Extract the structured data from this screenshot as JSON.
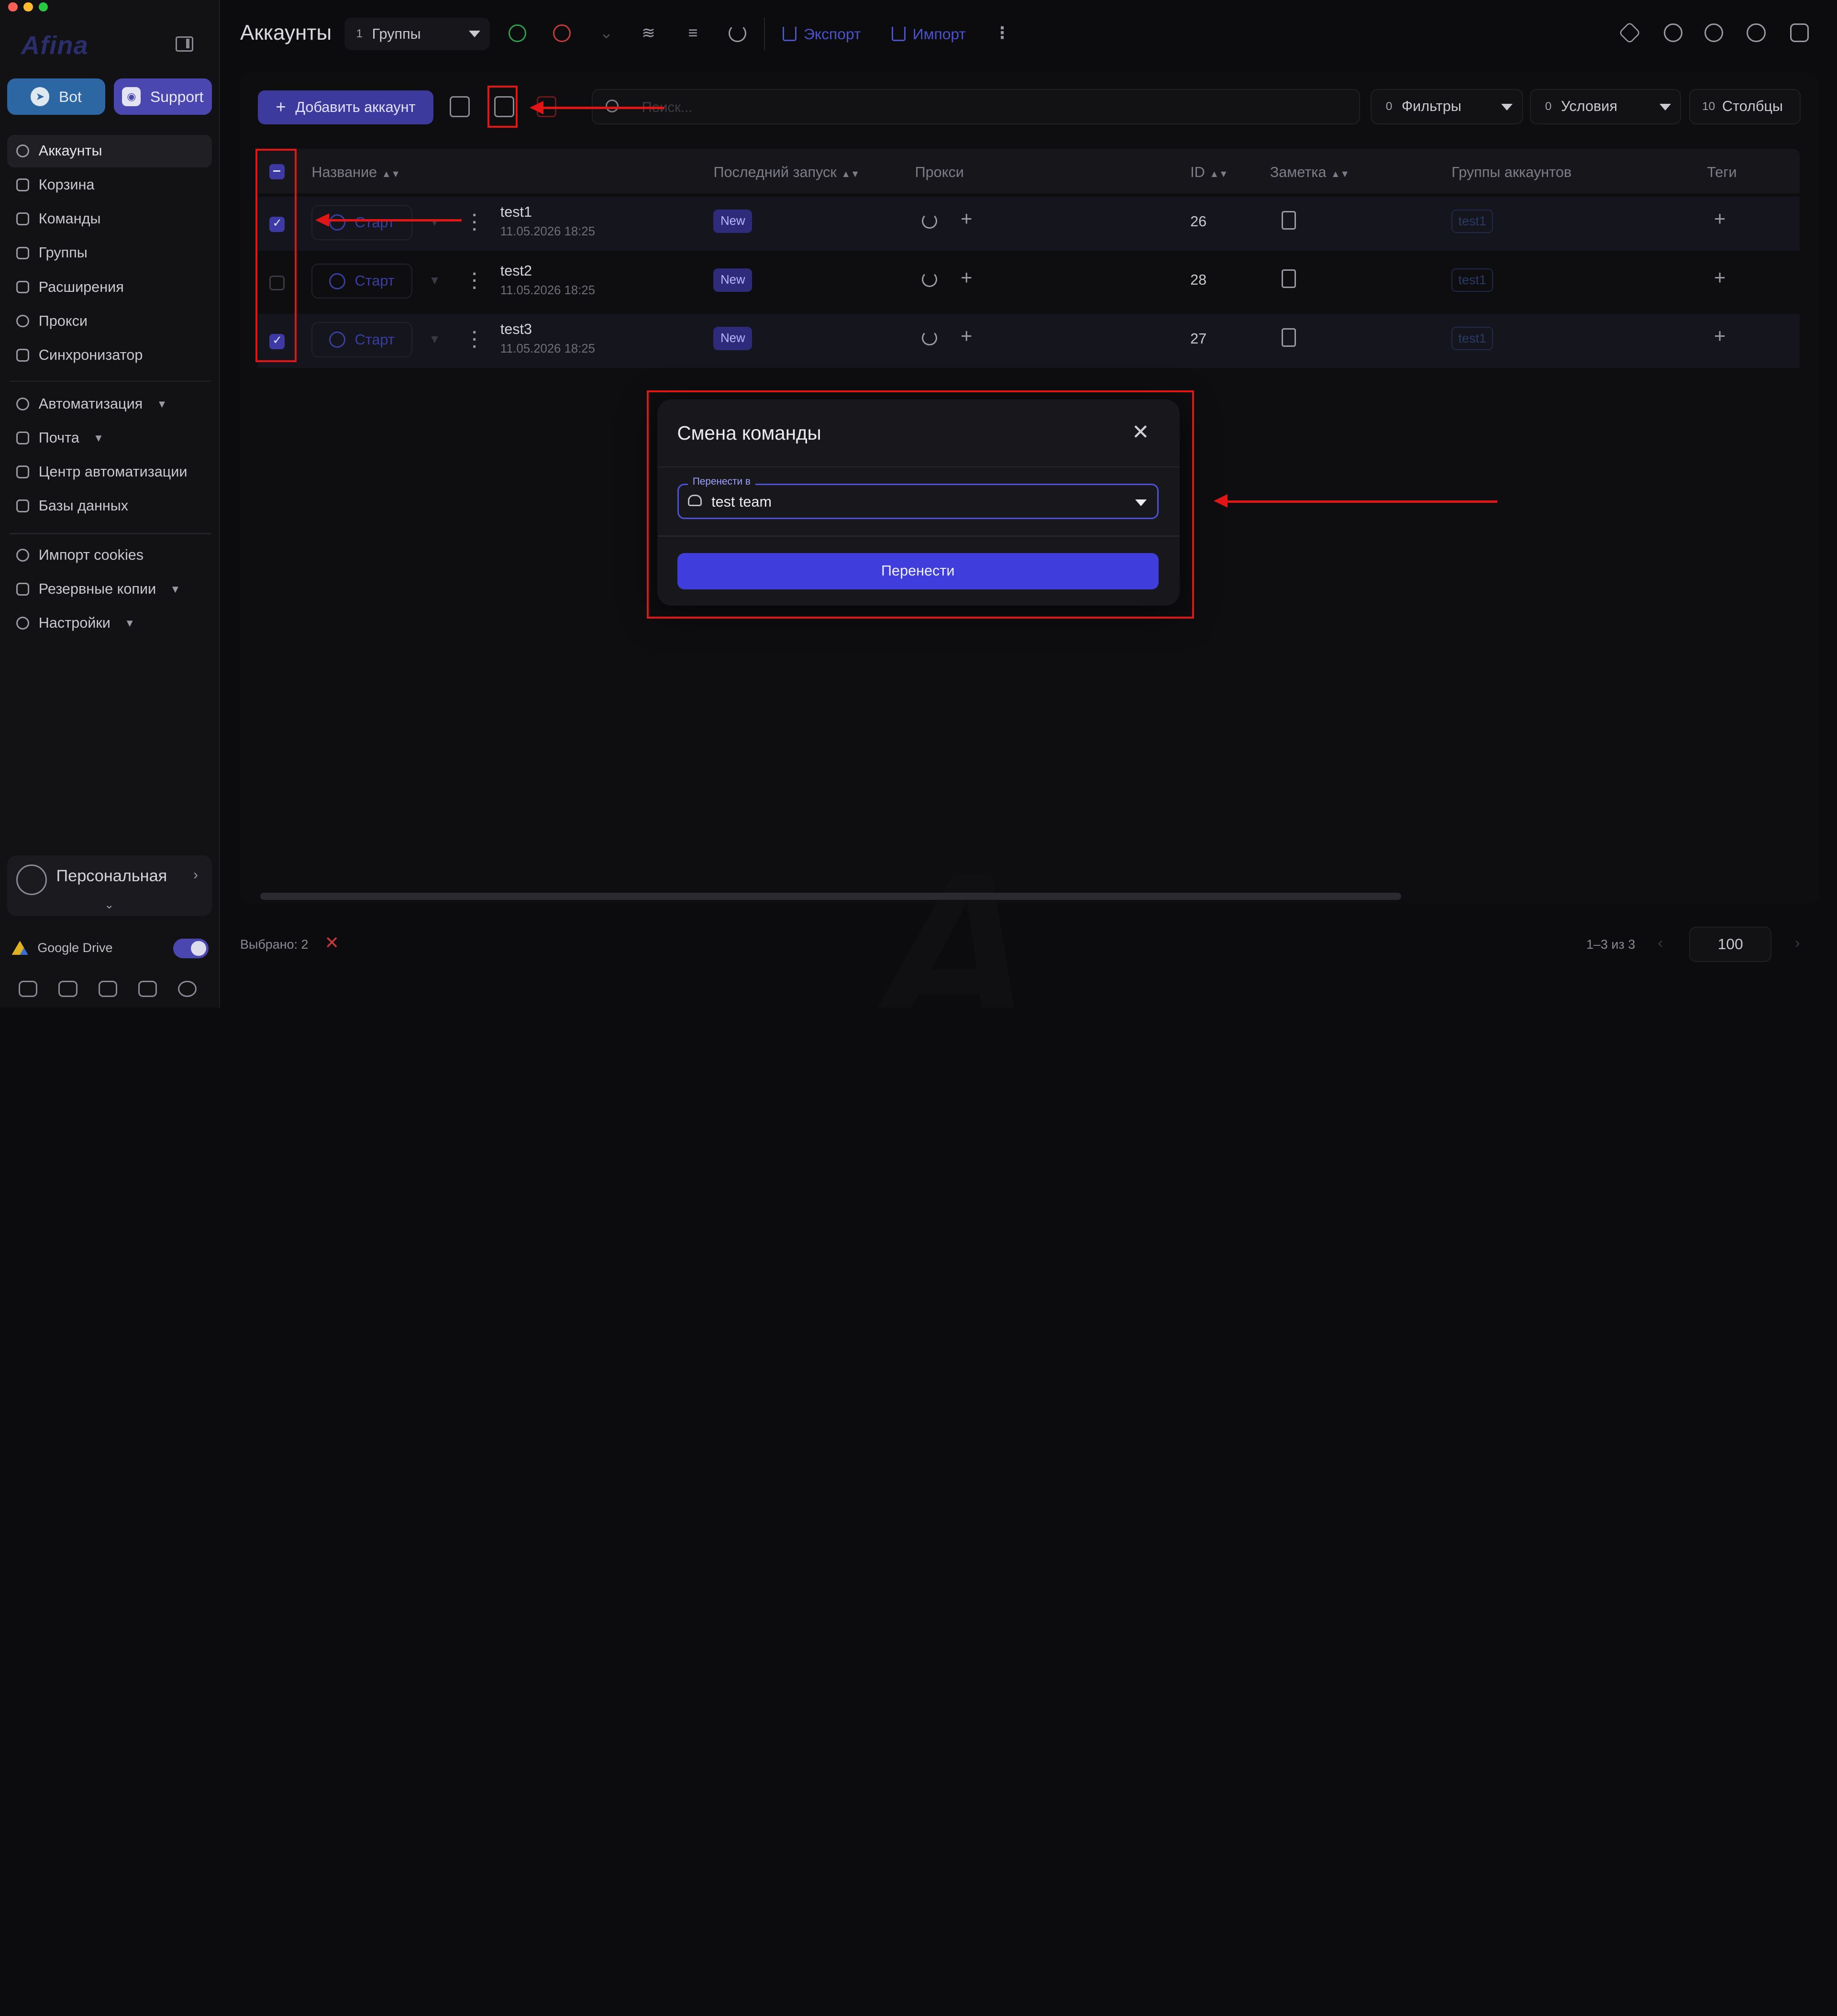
{
  "window": {
    "title": "Аккаунты"
  },
  "sidebar": {
    "logo": "Afina",
    "bot_label": "Bot",
    "support_label": "Support",
    "items": [
      {
        "label": "Аккаунты",
        "icon": "user-circle-icon",
        "active": true
      },
      {
        "label": "Корзина",
        "icon": "trash-icon"
      },
      {
        "label": "Команды",
        "icon": "team-icon"
      },
      {
        "label": "Группы",
        "icon": "group-icon"
      },
      {
        "label": "Расширения",
        "icon": "puzzle-icon"
      },
      {
        "label": "Прокси",
        "icon": "cloud-icon"
      },
      {
        "label": "Синхронизатор",
        "icon": "sync-icon"
      }
    ],
    "items2": [
      {
        "label": "Автоматизация",
        "icon": "automation-icon",
        "expandable": true
      },
      {
        "label": "Почта",
        "icon": "mail-icon",
        "expandable": true
      },
      {
        "label": "Центр автоматизации",
        "icon": "laptop-icon"
      },
      {
        "label": "Базы данных",
        "icon": "database-icon"
      }
    ],
    "items3": [
      {
        "label": "Импорт cookies",
        "icon": "cookie-icon"
      },
      {
        "label": "Резервные копии",
        "icon": "backup-icon",
        "expandable": true
      },
      {
        "label": "Настройки",
        "icon": "gear-icon",
        "expandable": true
      }
    ],
    "profile": {
      "name": "Персональная"
    },
    "gdrive": {
      "label": "Google Drive",
      "enabled": true
    }
  },
  "topbar": {
    "group_select": {
      "count": "1",
      "label": "Группы"
    },
    "export_label": "Экспорт",
    "import_label": "Импорт"
  },
  "toolbar": {
    "add_label": "Добавить аккаунт",
    "search_placeholder": "Поиск...",
    "filters": {
      "count": "0",
      "label": "Фильтры"
    },
    "conditions": {
      "count": "0",
      "label": "Условия"
    },
    "columns": {
      "count": "10",
      "label": "Столбцы"
    }
  },
  "table": {
    "columns": [
      "Название",
      "Последний запуск",
      "Прокси",
      "ID",
      "Заметка",
      "Группы аккаунтов",
      "Теги"
    ],
    "rows": [
      {
        "selected": true,
        "start": "Старт",
        "name": "test1",
        "date": "11.05.2026 18:25",
        "badge": "New",
        "id": "26",
        "group": "test1"
      },
      {
        "selected": false,
        "start": "Старт",
        "name": "test2",
        "date": "11.05.2026 18:25",
        "badge": "New",
        "id": "28",
        "group": "test1"
      },
      {
        "selected": true,
        "start": "Старт",
        "name": "test3",
        "date": "11.05.2026 18:25",
        "badge": "New",
        "id": "27",
        "group": "test1"
      }
    ]
  },
  "footer": {
    "selected_text": "Выбрано: 2",
    "pager_text": "1–3 из 3",
    "page_size": "100"
  },
  "modal": {
    "title": "Смена команды",
    "field_label": "Перенести в",
    "field_value": "test team",
    "submit_label": "Перенести"
  },
  "colors": {
    "accent": "#3f3ddb",
    "annotation": "#e01616",
    "play": "#2e9d4d",
    "stop": "#c73a3a"
  }
}
